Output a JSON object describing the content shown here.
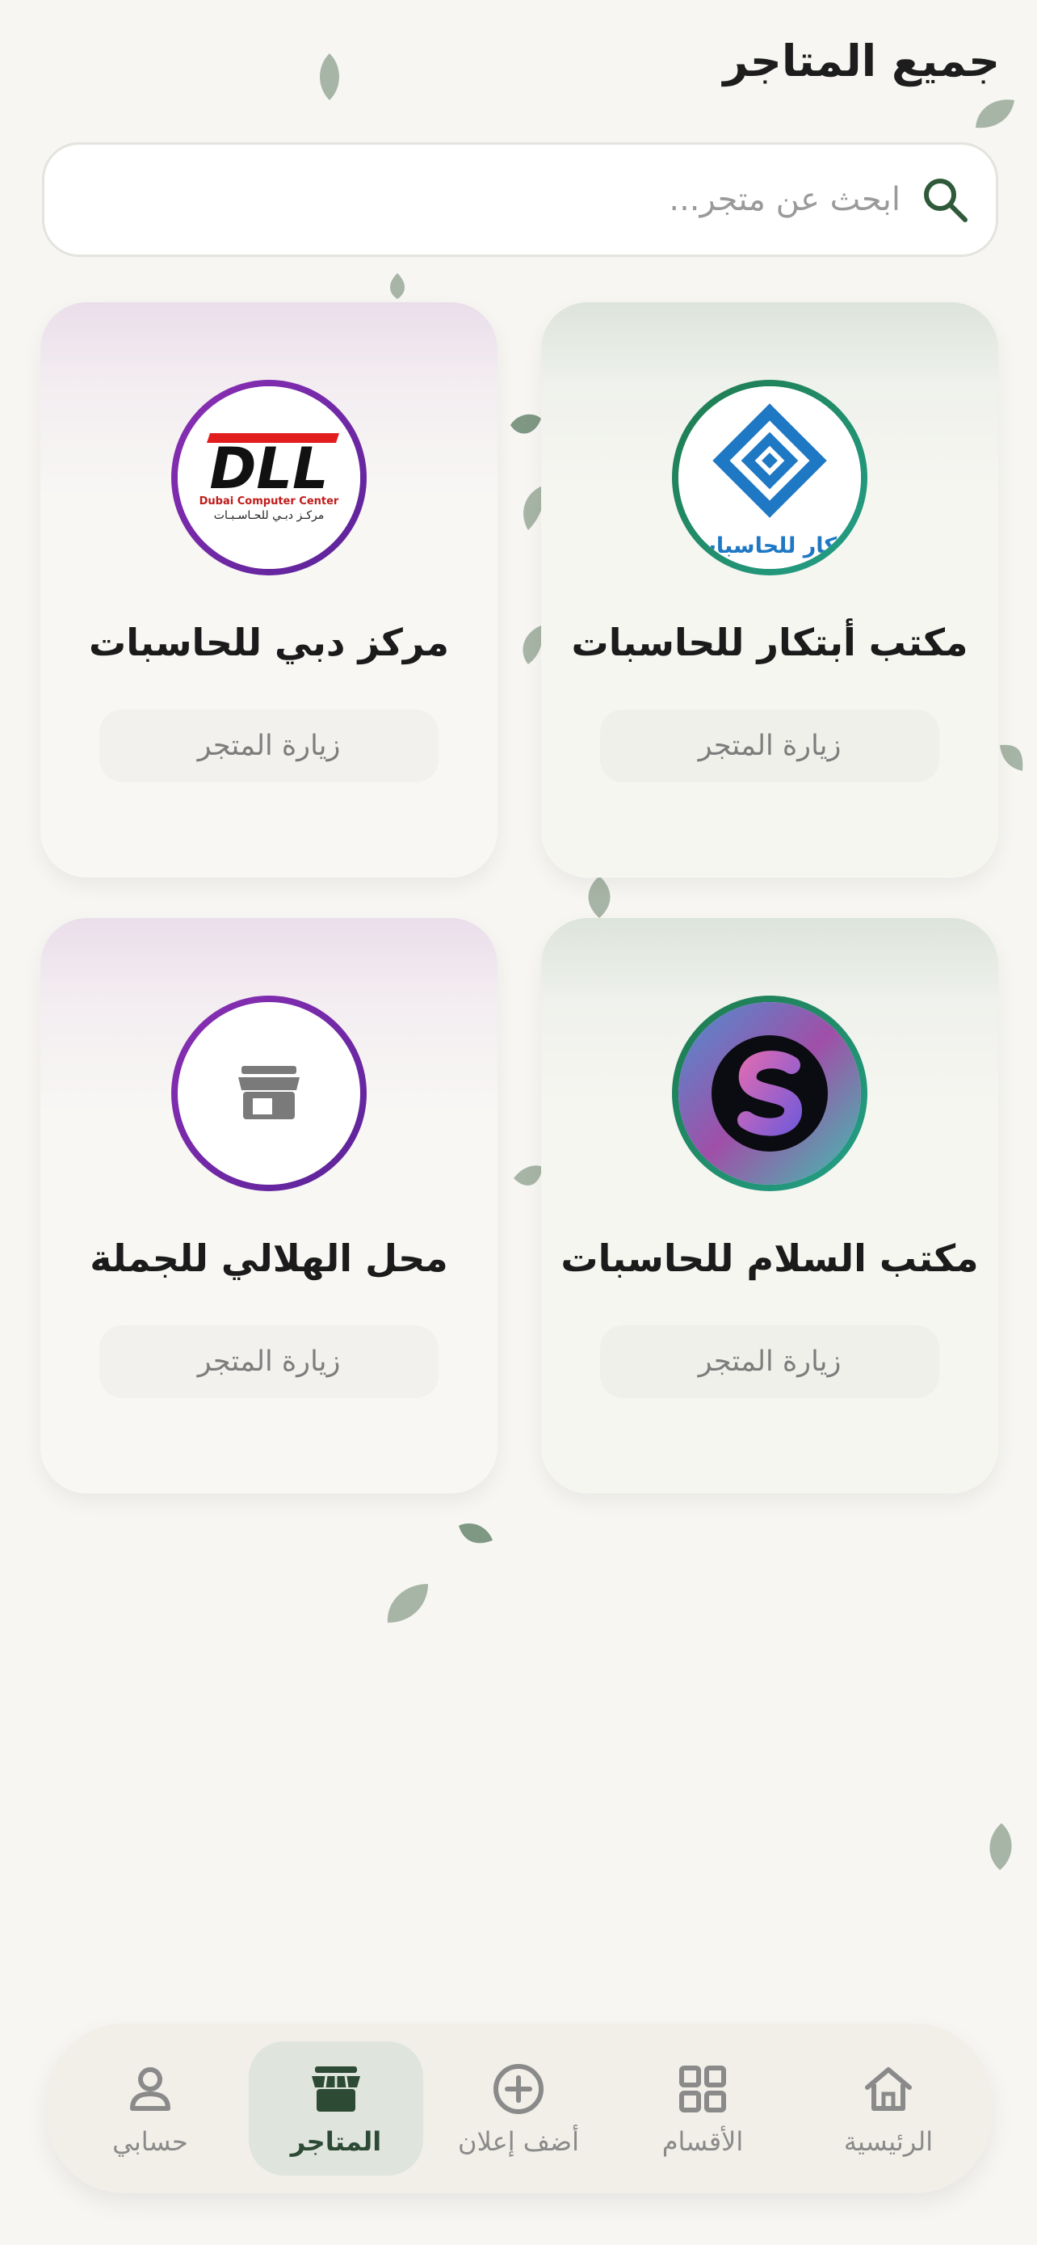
{
  "header": {
    "title": "جميع المتاجر"
  },
  "search": {
    "placeholder": "ابحث عن متجر..."
  },
  "stores": [
    {
      "name": "مكتب أبتكار للحاسبات",
      "visit_label": "زيارة المتجر",
      "logo_text": "تكار للحاسبات"
    },
    {
      "name": "مركز دبي للحاسبات",
      "visit_label": "زيارة المتجر",
      "logo_text_main": "DLL",
      "logo_text_en": "Dubai Computer Center",
      "logo_text_ar": "مركـز دبـي للحـاسـبـات"
    },
    {
      "name": "مكتب السلام للحاسبات",
      "visit_label": "زيارة المتجر"
    },
    {
      "name": "محل الهلالي للجملة",
      "visit_label": "زيارة المتجر"
    }
  ],
  "tabbar": {
    "home": "الرئيسية",
    "categories": "الأقسام",
    "add_ad": "أضف إعلان",
    "stores": "المتاجر",
    "account": "حسابي"
  },
  "colors": {
    "primary_dark_green": "#2d4a35",
    "leaf_green": "#a7b5a6",
    "ring_green": "#1f7a4d",
    "ring_purple": "#8b2fb5"
  }
}
